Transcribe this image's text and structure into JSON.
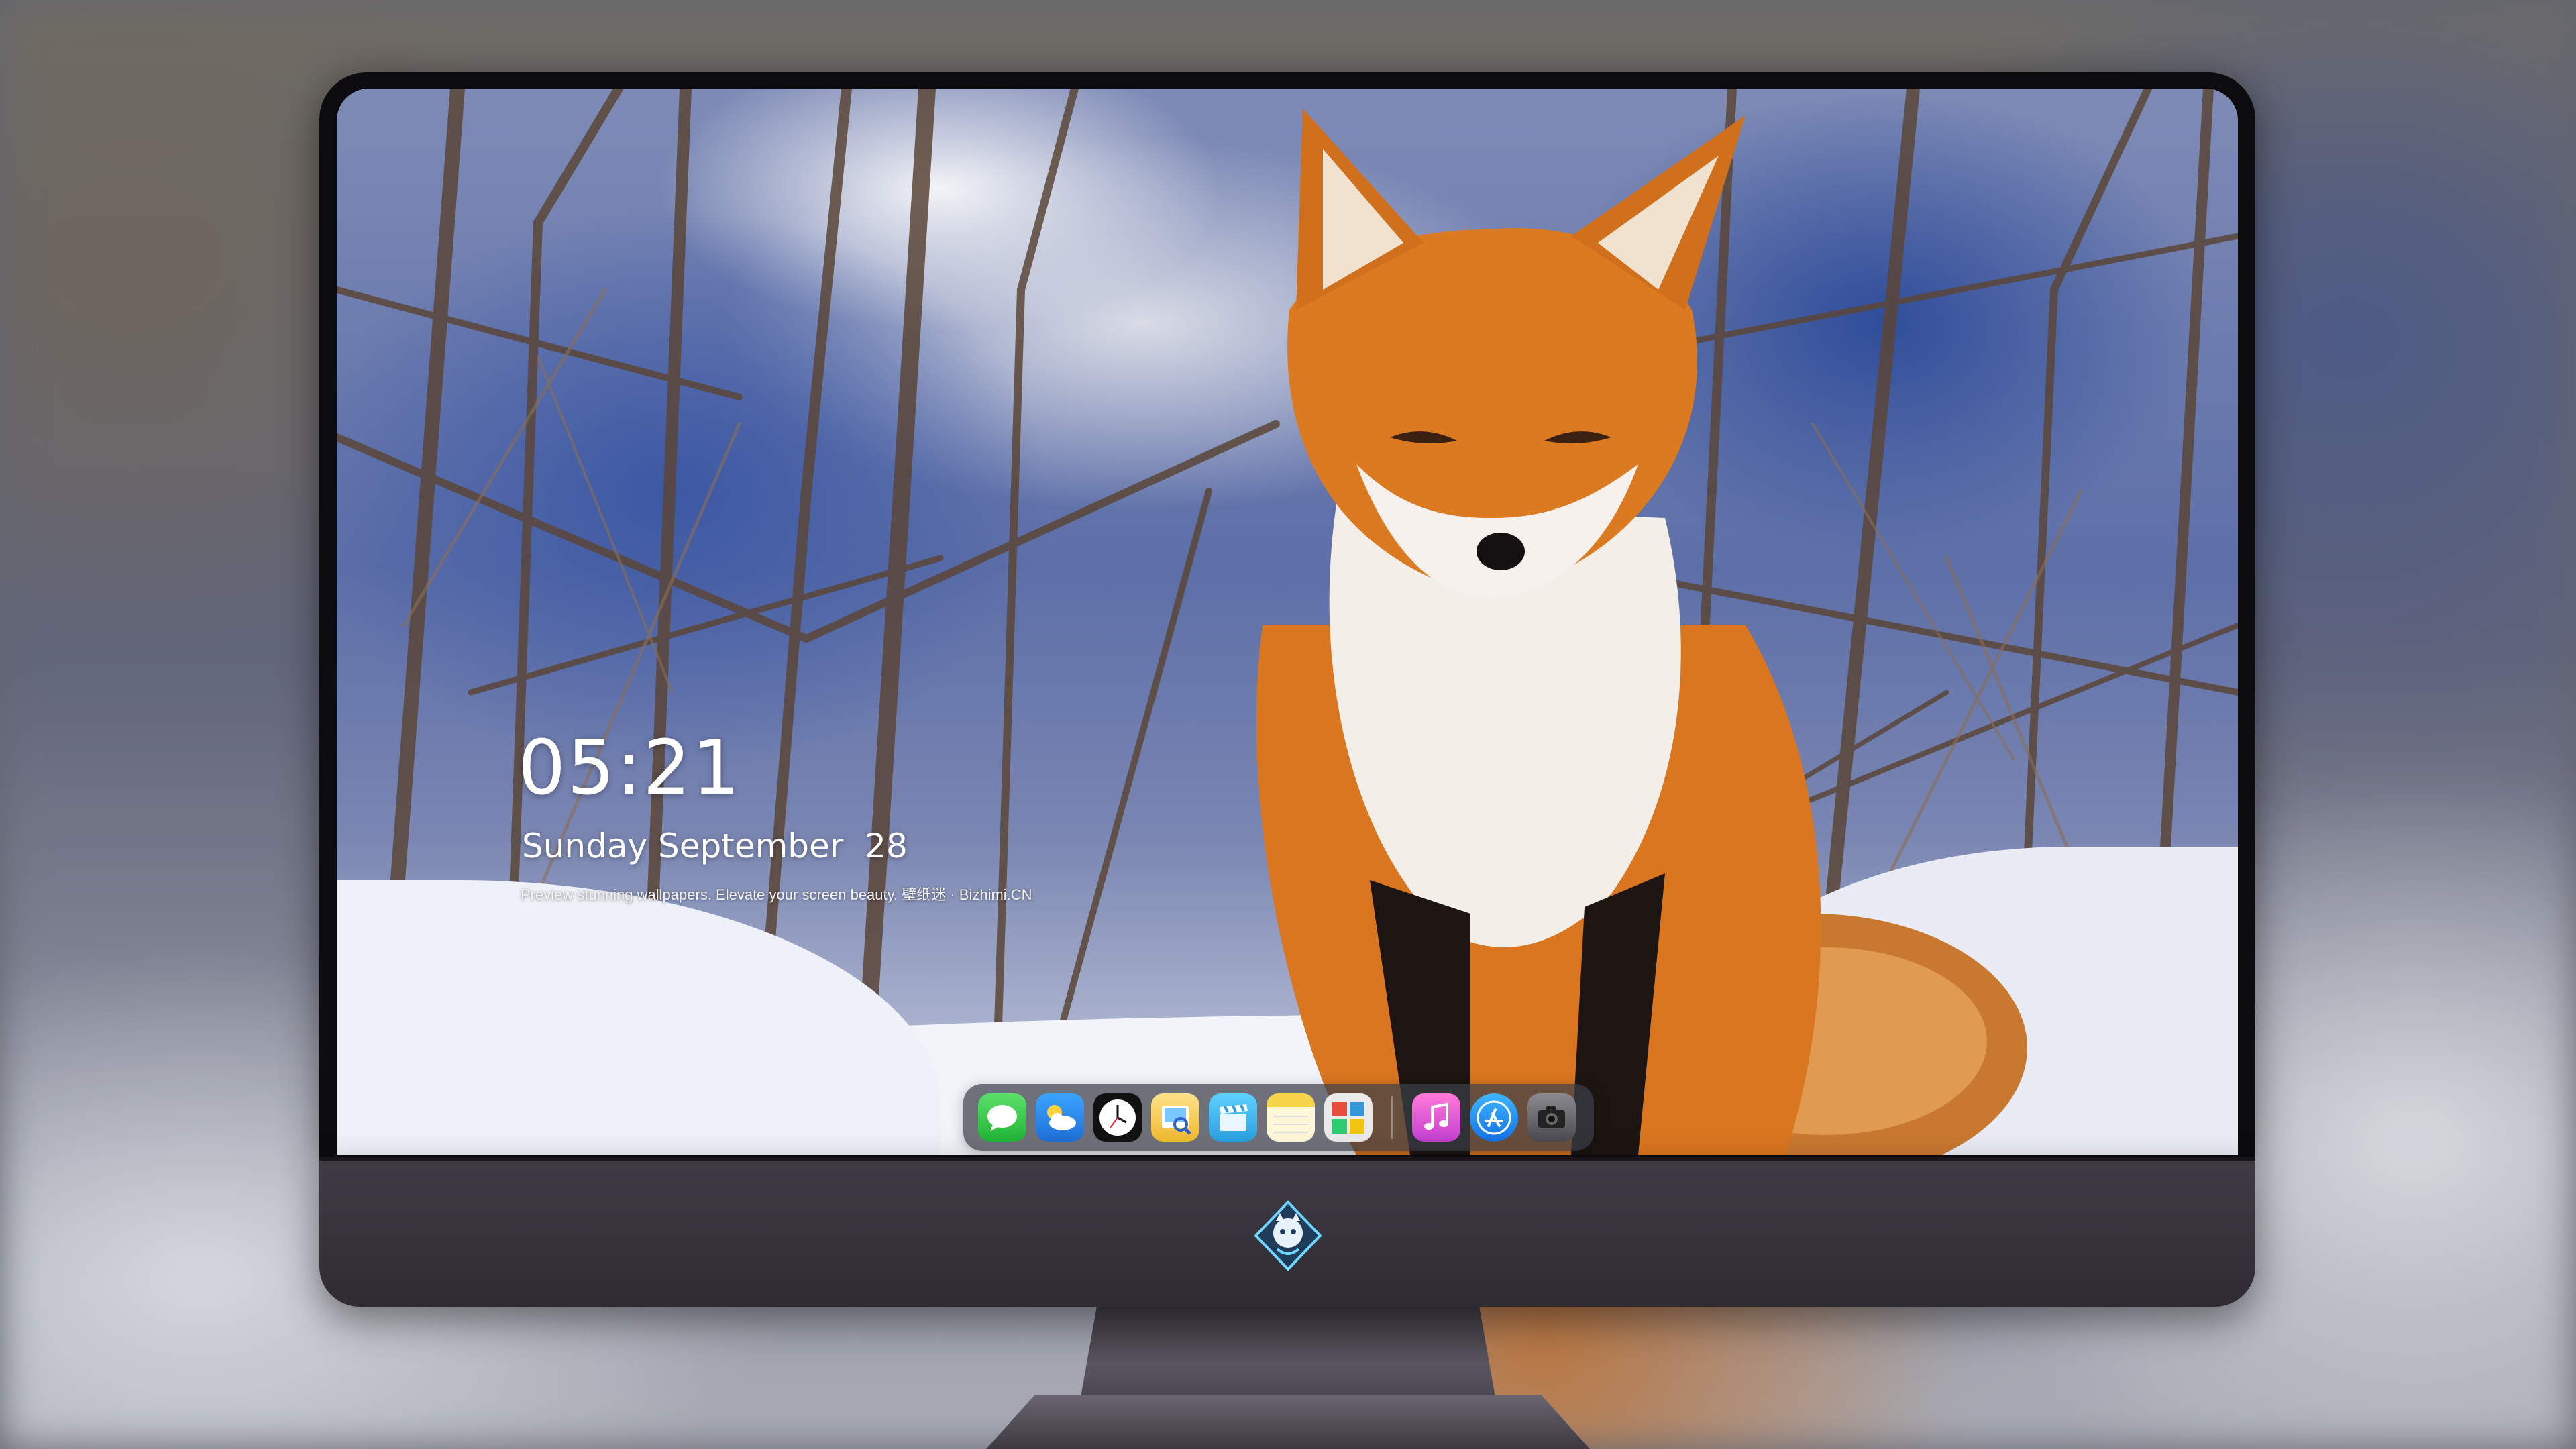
{
  "lockscreen": {
    "time": "05:21",
    "date": "Sunday September  28",
    "caption": "Preview stunning wallpapers. Elevate your screen beauty. 壁纸迷 · Bizhimi.CN"
  },
  "dock": {
    "apps": [
      {
        "name": "Messages",
        "icon": "messages-icon",
        "color": "#36c84b"
      },
      {
        "name": "Weather",
        "icon": "weather-icon",
        "color": "#2f8ff0"
      },
      {
        "name": "Clock",
        "icon": "clock-icon",
        "color": "#111111"
      },
      {
        "name": "Preview",
        "icon": "preview-icon",
        "color": "#f3c84a"
      },
      {
        "name": "Clips",
        "icon": "clapperboard-icon",
        "color": "#3fb5e8"
      },
      {
        "name": "Notes",
        "icon": "notes-icon",
        "color": "#f7d54a"
      },
      {
        "name": "Photo Booth",
        "icon": "photo-grid-icon",
        "color": "#e8e8e8"
      },
      {
        "name": "Music",
        "icon": "music-icon",
        "color": "#e84cc2"
      },
      {
        "name": "App Store",
        "icon": "app-store-icon",
        "color": "#1e90f5"
      },
      {
        "name": "Camera",
        "icon": "camera-icon",
        "color": "#5a5a5e"
      }
    ]
  },
  "colors": {
    "fox_orange": "#d9761f",
    "monitor_chin": "#3a353d",
    "dock_bg": "#3c3e48"
  }
}
